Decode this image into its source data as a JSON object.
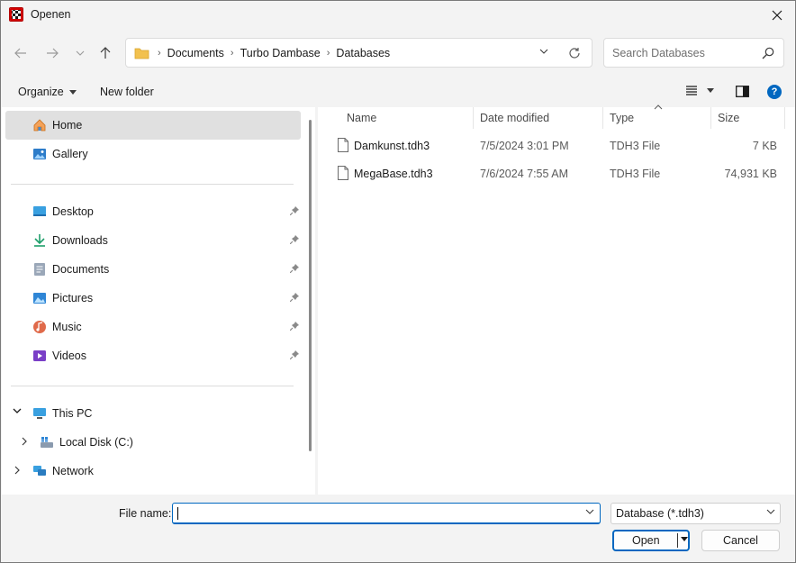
{
  "window": {
    "title": "Openen"
  },
  "nav": {
    "breadcrumbs": [
      "Documents",
      "Turbo Dambase",
      "Databases"
    ],
    "search_placeholder": "Search Databases"
  },
  "toolbar": {
    "organize": "Organize",
    "new_folder": "New folder"
  },
  "sidebar": {
    "quick": [
      {
        "label": "Home",
        "icon": "home-icon",
        "selected": true
      },
      {
        "label": "Gallery",
        "icon": "gallery-icon"
      }
    ],
    "pinned": [
      {
        "label": "Desktop",
        "icon": "desktop-icon"
      },
      {
        "label": "Downloads",
        "icon": "download-icon"
      },
      {
        "label": "Documents",
        "icon": "documents-icon"
      },
      {
        "label": "Pictures",
        "icon": "pictures-icon"
      },
      {
        "label": "Music",
        "icon": "music-icon"
      },
      {
        "label": "Videos",
        "icon": "videos-icon"
      }
    ],
    "tree": [
      {
        "label": "This PC",
        "icon": "pc-icon",
        "expanded": true
      },
      {
        "label": "Local Disk (C:)",
        "icon": "disk-icon"
      },
      {
        "label": "Network",
        "icon": "network-icon"
      }
    ]
  },
  "columns": {
    "name": "Name",
    "date": "Date modified",
    "type": "Type",
    "size": "Size"
  },
  "files": [
    {
      "name": "Damkunst.tdh3",
      "date": "7/5/2024 3:01 PM",
      "type": "TDH3 File",
      "size": "7 KB"
    },
    {
      "name": "MegaBase.tdh3",
      "date": "7/6/2024 7:55 AM",
      "type": "TDH3 File",
      "size": "74,931 KB"
    }
  ],
  "footer": {
    "file_name_label": "File name:",
    "file_name_value": "",
    "file_type": "Database (*.tdh3)",
    "open_label": "Open",
    "cancel_label": "Cancel"
  },
  "colors": {
    "accent": "#0067c0",
    "folder": "#f2c14e",
    "selected": "#e0e0e0"
  }
}
